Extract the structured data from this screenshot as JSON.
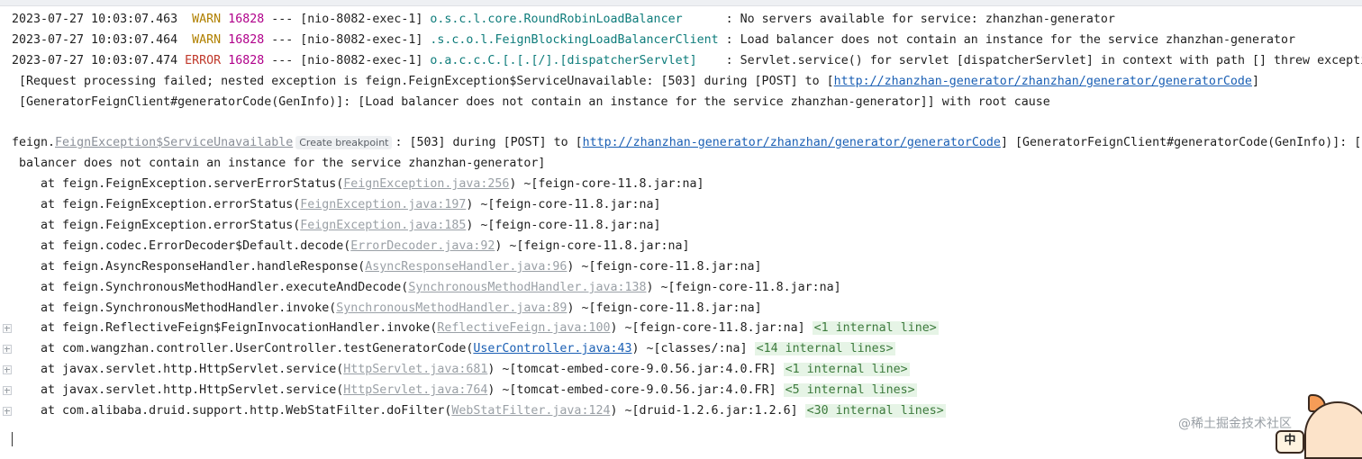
{
  "logs": [
    {
      "ts": "2023-07-27 10:03:07.463",
      "level": "WARN",
      "pid": "16828",
      "sep": "---",
      "thread": "[nio-8082-exec-1]",
      "logger": "o.s.c.l.core.RoundRobinLoadBalancer     ",
      "msg": ": No servers available for service: zhanzhan-generator"
    },
    {
      "ts": "2023-07-27 10:03:07.464",
      "level": "WARN",
      "pid": "16828",
      "sep": "---",
      "thread": "[nio-8082-exec-1]",
      "logger": ".s.c.o.l.FeignBlockingLoadBalancerClient",
      "msg": ": Load balancer does not contain an instance for the service zhanzhan-generator"
    },
    {
      "ts": "2023-07-27 10:03:07.474",
      "level": "ERROR",
      "pid": "16828",
      "sep": "---",
      "thread": "[nio-8082-exec-1]",
      "logger": "o.a.c.c.C.[.[.[/].[dispatcherServlet]   ",
      "msg": ": Servlet.service() for servlet [dispatcherServlet] in context with path [] threw exception"
    }
  ],
  "cont1": {
    "pre": " [Request processing failed; nested exception is feign.FeignException$ServiceUnavailable: [503] during [POST] to [",
    "url": "http://zhanzhan-generator/zhanzhan/generator/generatorCode",
    "post": "]"
  },
  "cont2": {
    "text": " [GeneratorFeignClient#generatorCode(GenInfo)]: [Load balancer does not contain an instance for the service zhanzhan-generator]] with root cause"
  },
  "exception": {
    "prefix": "feign.",
    "cls": "FeignException$ServiceUnavailable",
    "breakpoint": "Create breakpoint",
    "mid": ": [503] during [POST] to [",
    "url": "http://zhanzhan-generator/zhanzhan/generator/generatorCode",
    "post": "] [GeneratorFeignClient#generatorCode(GenInfo)]: [Load",
    "cont": " balancer does not contain an instance for the service zhanzhan-generator]"
  },
  "stack": [
    {
      "pre": "    at feign.FeignException.serverErrorStatus(",
      "link": "FeignException.java:256",
      "post": ") ~[feign-core-11.8.jar:na]",
      "fold": "",
      "gutter": false,
      "active": false
    },
    {
      "pre": "    at feign.FeignException.errorStatus(",
      "link": "FeignException.java:197",
      "post": ") ~[feign-core-11.8.jar:na]",
      "fold": "",
      "gutter": false,
      "active": false
    },
    {
      "pre": "    at feign.FeignException.errorStatus(",
      "link": "FeignException.java:185",
      "post": ") ~[feign-core-11.8.jar:na]",
      "fold": "",
      "gutter": false,
      "active": false
    },
    {
      "pre": "    at feign.codec.ErrorDecoder$Default.decode(",
      "link": "ErrorDecoder.java:92",
      "post": ") ~[feign-core-11.8.jar:na]",
      "fold": "",
      "gutter": false,
      "active": false
    },
    {
      "pre": "    at feign.AsyncResponseHandler.handleResponse(",
      "link": "AsyncResponseHandler.java:96",
      "post": ") ~[feign-core-11.8.jar:na]",
      "fold": "",
      "gutter": false,
      "active": false
    },
    {
      "pre": "    at feign.SynchronousMethodHandler.executeAndDecode(",
      "link": "SynchronousMethodHandler.java:138",
      "post": ") ~[feign-core-11.8.jar:na]",
      "fold": "",
      "gutter": false,
      "active": false
    },
    {
      "pre": "    at feign.SynchronousMethodHandler.invoke(",
      "link": "SynchronousMethodHandler.java:89",
      "post": ") ~[feign-core-11.8.jar:na]",
      "fold": "",
      "gutter": false,
      "active": false
    },
    {
      "pre": "    at feign.ReflectiveFeign$FeignInvocationHandler.invoke(",
      "link": "ReflectiveFeign.java:100",
      "post": ") ~[feign-core-11.8.jar:na] ",
      "fold": "<1 internal line>",
      "gutter": true,
      "active": false
    },
    {
      "pre": "    at com.wangzhan.controller.UserController.testGeneratorCode(",
      "link": "UserController.java:43",
      "post": ") ~[classes/:na] ",
      "fold": "<14 internal lines>",
      "gutter": true,
      "active": true
    },
    {
      "pre": "    at javax.servlet.http.HttpServlet.service(",
      "link": "HttpServlet.java:681",
      "post": ") ~[tomcat-embed-core-9.0.56.jar:4.0.FR] ",
      "fold": "<1 internal line>",
      "gutter": true,
      "active": false
    },
    {
      "pre": "    at javax.servlet.http.HttpServlet.service(",
      "link": "HttpServlet.java:764",
      "post": ") ~[tomcat-embed-core-9.0.56.jar:4.0.FR] ",
      "fold": "<5 internal lines>",
      "gutter": true,
      "active": false
    },
    {
      "pre": "    at com.alibaba.druid.support.http.WebStatFilter.doFilter(",
      "link": "WebStatFilter.java:124",
      "post": ") ~[druid-1.2.6.jar:1.2.6] ",
      "fold": "<30 internal lines>",
      "gutter": true,
      "active": false
    }
  ],
  "watermark": "@稀土掘金技术社区",
  "mascot_badge": "中"
}
